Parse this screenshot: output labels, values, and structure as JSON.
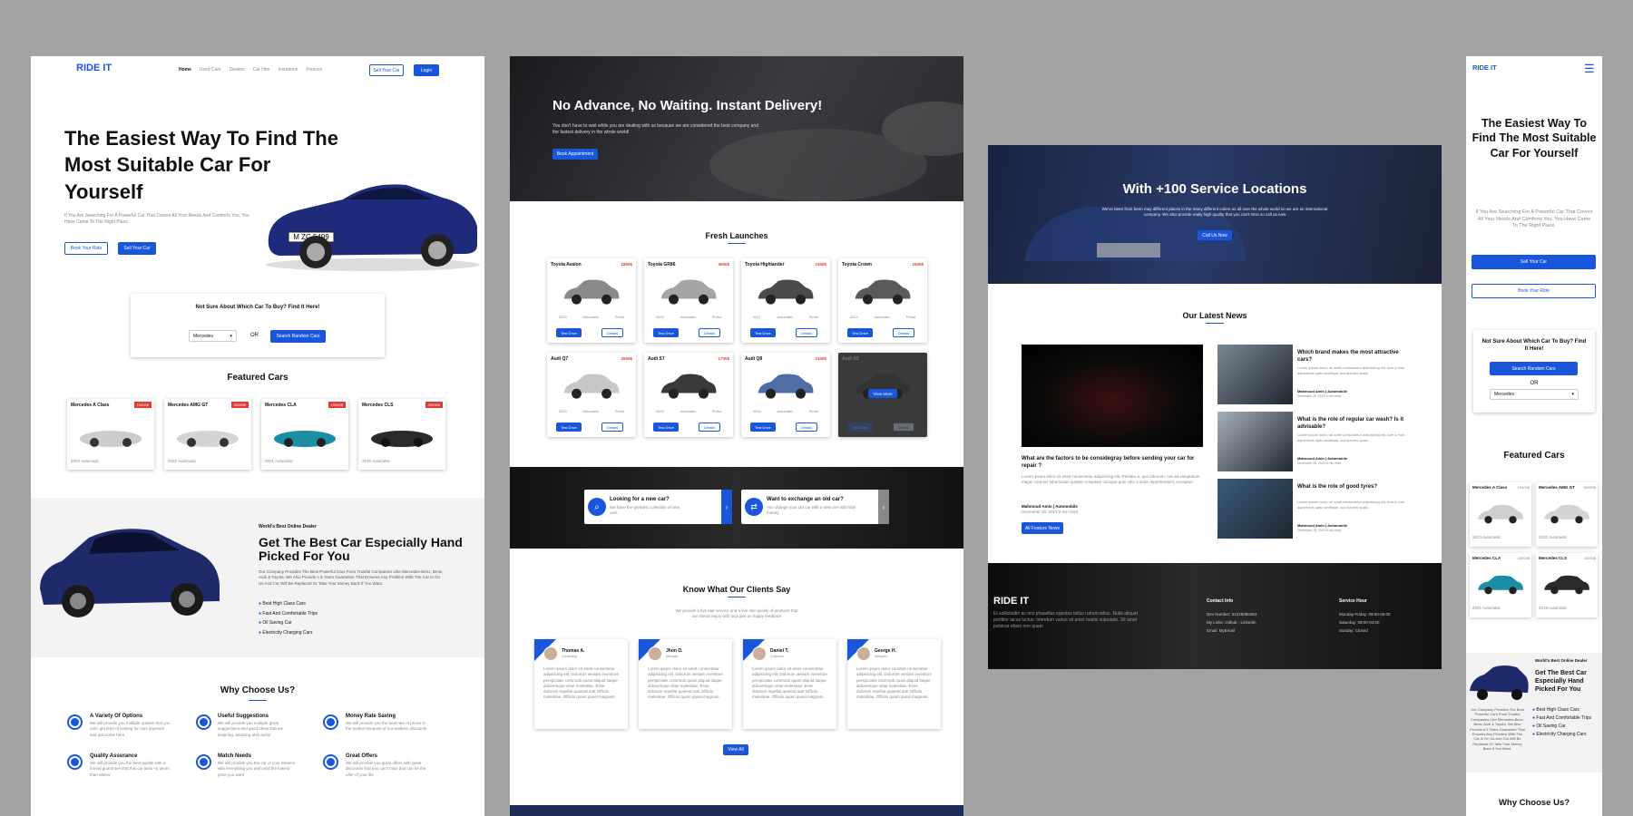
{
  "brand": "RIDE IT",
  "nav": {
    "items": [
      "Home",
      "Used Cars",
      "Dealers",
      "Car Hire",
      "Insurance",
      "Finance"
    ],
    "sell": "Sell Your Car",
    "login": "Login"
  },
  "hero": {
    "title": "The Easiest Way To Find The Most Suitable Car For Yourself",
    "text": "If You Are Searching For A Powerful Car That Covers All Your Needs And Comforts You, You Have Came To The Right Place.",
    "book": "Book Your Ride",
    "sell": "Sell Your Car",
    "plate": "M ZC 5499"
  },
  "finder": {
    "title": "Not Sure About Which Car To Buy? Find It Here!",
    "select": "Mercedes",
    "or": "OR",
    "button": "Search Random Cars"
  },
  "featured": {
    "title": "Featured Cars",
    "cars": [
      {
        "name": "Mercedes A Class",
        "price": "10000$",
        "info": "2023 Automatic"
      },
      {
        "name": "Mercedes AMG GT",
        "price": "50000$",
        "info": "2022 Automatic"
      },
      {
        "name": "Mercedes CLA",
        "price": "15000$",
        "info": "2021 Automatic"
      },
      {
        "name": "Mercedes CLS",
        "price": "30000$",
        "info": "2019 Automatic"
      }
    ]
  },
  "dealer": {
    "kicker": "World's Best Online Dealer",
    "title": "Get The Best Car Especially Hand Picked For You",
    "text": "Our Company Provides The Best Powerful Cars From Trustful Companies Like Mercedes-Benz, Bmw, Audi & Toyota. We Also Provide A 5 Years Guarantee That Ensures Any Problem With The Car Is On Us And Car Will Be Replaced Or Take Your Money Back If You Want.",
    "points": [
      "Best High Class Cars",
      "Fast And Comfortable Trips",
      "Oil Saving Car",
      "Electricity Charging Cars"
    ]
  },
  "why": {
    "title": "Why Choose Us?",
    "items": [
      {
        "title": "A Variety Of Options",
        "text": "We will provide you multiple options that you can't get tired of looking for cars anymore and just come here"
      },
      {
        "title": "Useful Suggestions",
        "text": "We will provide you multiple great suggestions and good ideas that are inspiring, amazing and useful"
      },
      {
        "title": "Money Rate Saving",
        "text": "We will provide you the best rate of prices in the market because of our endless discounts"
      },
      {
        "title": "Quality Assurance",
        "text": "We will provide you the best quality with a formal guarantee that this car lasts +5 years than others"
      },
      {
        "title": "Match Needs",
        "text": "We will provide you the car of your dreams with everything you wish and the lowest price you want"
      },
      {
        "title": "Great Offers",
        "text": "We will provide you great offers with great discounts that you can't miss that can be the offer of your life"
      }
    ]
  },
  "delivery": {
    "title": "No Advance, No Waiting. Instant Delivery!",
    "text": "You don't have to wait while you are dealing with us because we are considered the best company and the fastest delivery in the whole world!",
    "button": "Book Appointment"
  },
  "launches": {
    "title": "Fresh Launches",
    "test": "Test Drive",
    "details": "Details",
    "more": "View More",
    "cars": [
      {
        "name": "Toyota Avalon",
        "price": "1800$",
        "year": "2023",
        "gear": "Automatic",
        "fuel": "Petrol"
      },
      {
        "name": "Toyota GR86",
        "price": "3000$",
        "year": "2022",
        "gear": "Automatic",
        "fuel": "Petrol"
      },
      {
        "name": "Toyota Highlander",
        "price": "2300$",
        "year": "2017",
        "gear": "Automatic",
        "fuel": "Petrol"
      },
      {
        "name": "Toyota Crown",
        "price": "1500$",
        "year": "2023",
        "gear": "Automatic",
        "fuel": "Petrol"
      },
      {
        "name": "Audi Q7",
        "price": "2500$",
        "year": "2023",
        "gear": "Automatic",
        "fuel": "Petrol"
      },
      {
        "name": "Audi S7",
        "price": "1700$",
        "year": "2023",
        "gear": "Automatic",
        "fuel": "Petrol"
      },
      {
        "name": "Audi Q8",
        "price": "2100$",
        "year": "2020",
        "gear": "Automatic",
        "fuel": "Petrol"
      },
      {
        "name": "Audi S3",
        "price": "",
        "year": "",
        "gear": "",
        "fuel": ""
      }
    ]
  },
  "cta": {
    "a_title": "Looking for a new car?",
    "a_text": "We have the greatest collection of new cars",
    "b_title": "Want to exchange an old car?",
    "b_text": "You change your old car with a new one with little money"
  },
  "clients": {
    "title": "Know What Our Clients Say",
    "text": "We provide a five star service and a five star quality of products that our clients enjoy with and give us happy feedback",
    "list": [
      {
        "name": "Thomas A.",
        "role": "Consulting"
      },
      {
        "name": "Jhon D.",
        "role": "Manager"
      },
      {
        "name": "Daniel T.",
        "role": "Customer"
      },
      {
        "name": "George H.",
        "role": "Designer"
      }
    ],
    "quote": "Lorem ipsum dolor sit amet consectetur adipisicing elit. Dolorum veniam inventore perspiciatis commodi quasi aliquid itaque doloremque vitae molestiae. Esse dolorum repellat quaerat aut! Officiis molestiae. Officiis quam quasi magnam.",
    "all": "View All"
  },
  "locations": {
    "title": "With +100 Service Locations",
    "text": "We've been from been may different places in the many different colors as all over the whole world so we are an international company. We also provide really high quality that you can't miss so call us now",
    "button": "Call Us Now"
  },
  "news": {
    "title": "Our Latest News",
    "main": {
      "title": "What are the factors to be considegray before sending your car for repair ?",
      "text": "Lorem ipsum dolor sit amet consectetur adipisicing elit. Pariatur a, quo laborum, nisi ad voluptatum magni corporis laboriosam quidem voluptate cumque quis odio a dolor reprehenderit, excepturi.",
      "author": "Mahmoud Amin",
      "cat": "Automobile",
      "date": "December 26, 2023 6 min read"
    },
    "items": [
      {
        "title": "Which brand makes the most attractive cars?",
        "text": "Lorem ipsum dolor, sit amet consectetur adipisicing elit. Iure a eum asperiores optio similique, aut dolores quasi.",
        "author": "Mahmoud Amin",
        "cat": "Automobile",
        "date": "December 26, 2023 6 min read"
      },
      {
        "title": "What is the role of regular car wash? Is it advisable?",
        "text": "Lorem ipsum dolor, sit amet consectetur adipisicing elit. Iure a eum asperiores optio similique, aut dolores quasi.",
        "author": "Mahmoud Amin",
        "cat": "Automobile",
        "date": "December 26, 2023 6 min read"
      },
      {
        "title": "What is the role of good tyres?",
        "text": "Lorem ipsum dolor, sit amet consectetur adipisicing elit. Iure a eum asperiores optio similique, aut dolores quasi.",
        "author": "Mahmoud Amin",
        "cat": "Automobile",
        "date": "December 26, 2023 6 min read"
      }
    ],
    "button": "All Feature News"
  },
  "footer": {
    "text": "Et sollicitudin ac orci phasellus egestas tellus rutrum tellus. Nulla aliquet porttitor lacus luctus. Interdum varius sit amet mattis vulputate. Sit amet pulvinar etiam non quam",
    "contact_title": "Contact Info",
    "contact": [
      "Dev Number: 01228050484",
      "My Links: Github - LinkedIn",
      "Email: MyEmail"
    ],
    "hours_title": "Service Hour",
    "hours": [
      "Monday-Friday: 09:00-06:00",
      "Saturday: 09:00-04:00",
      "Sunday: Closed"
    ]
  },
  "mobile": {
    "hero_title": "The Easiest Way To Find The Most Suitable Car For Yourself",
    "hero_text": "If You Are Searching For A Powerful Car That Covers All Your Needs And Comforts You, You Have Came To The Right Place.",
    "sell": "Sell Your Car",
    "book": "Book Your Ride",
    "finder_title": "Not Sure About Which Car To Buy? Find It Here!",
    "finder_button": "Search Random Cars",
    "or": "OR",
    "select": "Mercedes",
    "featured": "Featured Cars",
    "cars": [
      {
        "name": "Mercedes A Class",
        "price": "10000$",
        "info": "2023 Automatic"
      },
      {
        "name": "Mercedes AMG GT",
        "price": "50000$",
        "info": "2022 Automatic"
      },
      {
        "name": "Mercedes CLA",
        "price": "15000$",
        "info": "2021 Automatic"
      },
      {
        "name": "Mercedes CLS",
        "price": "30000$",
        "info": "2019 Automatic"
      }
    ],
    "kicker": "World's Best Online Dealer",
    "dealer_title": "Get The Best Car Especially Hand Picked For You",
    "dealer_text": "Our Company Provides The Best Powerful Cars From Trustful Companies Like Mercedes-Benz, Bmw, Audi & Toyota. We Also Provide A 5 Years Guarantee That Ensures Any Problem With The Car Is On Us And Car Will Be Replaced Or Take Your Money Back If You Want.",
    "points": [
      "Best High Class Cars",
      "Fast And Comfortable Trips",
      "Oil Saving Car",
      "Electricity Charging Cars"
    ],
    "why": "Why Choose Us?"
  },
  "colors": {
    "accent": "#1a56db",
    "price": "#e53935",
    "dark": "#1d1d1f"
  }
}
